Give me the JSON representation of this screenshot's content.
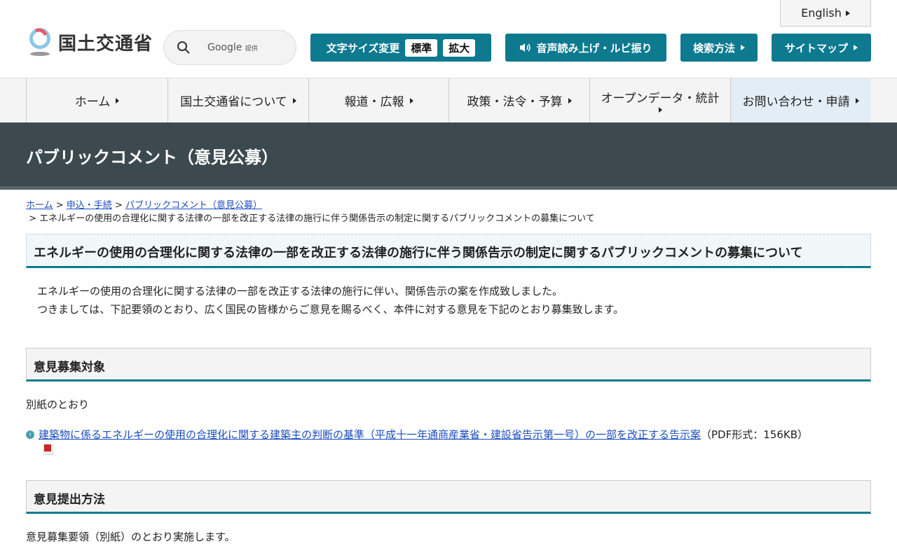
{
  "header": {
    "english": "English",
    "logo_text": "国土交通省",
    "search_google": "Google",
    "search_provided": "提供",
    "font_size_label": "文字サイズ変更",
    "font_standard": "標準",
    "font_large": "拡大",
    "voice_label": "音声読み上げ・ルビ振り",
    "search_method": "検索方法",
    "sitemap": "サイトマップ"
  },
  "nav": [
    "ホーム",
    "国土交通省について",
    "報道・広報",
    "政策・法令・予算",
    "オープンデータ・統計",
    "お問い合わせ・申請"
  ],
  "banner_title": "パブリックコメント（意見公募）",
  "breadcrumb": {
    "items": [
      "ホーム",
      "申込・手続",
      "パブリックコメント（意見公募）"
    ],
    "current": "エネルギーの使用の合理化に関する法律の一部を改正する法律の施行に伴う関係告示の制定に関するパブリックコメントの募集について"
  },
  "page_title": "エネルギーの使用の合理化に関する法律の一部を改正する法律の施行に伴う関係告示の制定に関するパブリックコメントの募集について",
  "intro": [
    "エネルギーの使用の合理化に関する法律の一部を改正する法律の施行に伴い、関係告示の案を作成致しました。",
    "つきましては、下記要領のとおり、広く国民の皆様からご意見を賜るべく、本件に対する意見を下記のとおり募集致します。"
  ],
  "section1": {
    "title": "意見募集対象",
    "text": "別紙のとおり",
    "link": "建築物に係るエネルギーの使用の合理化に関する建築主の判断の基準（平成十一年通商産業省・建設省告示第一号）の一部を改正する告示案",
    "link_meta": "（PDF形式：156KB）"
  },
  "section2": {
    "title": "意見提出方法",
    "text": "意見募集要領（別紙）のとおり実施します。"
  }
}
